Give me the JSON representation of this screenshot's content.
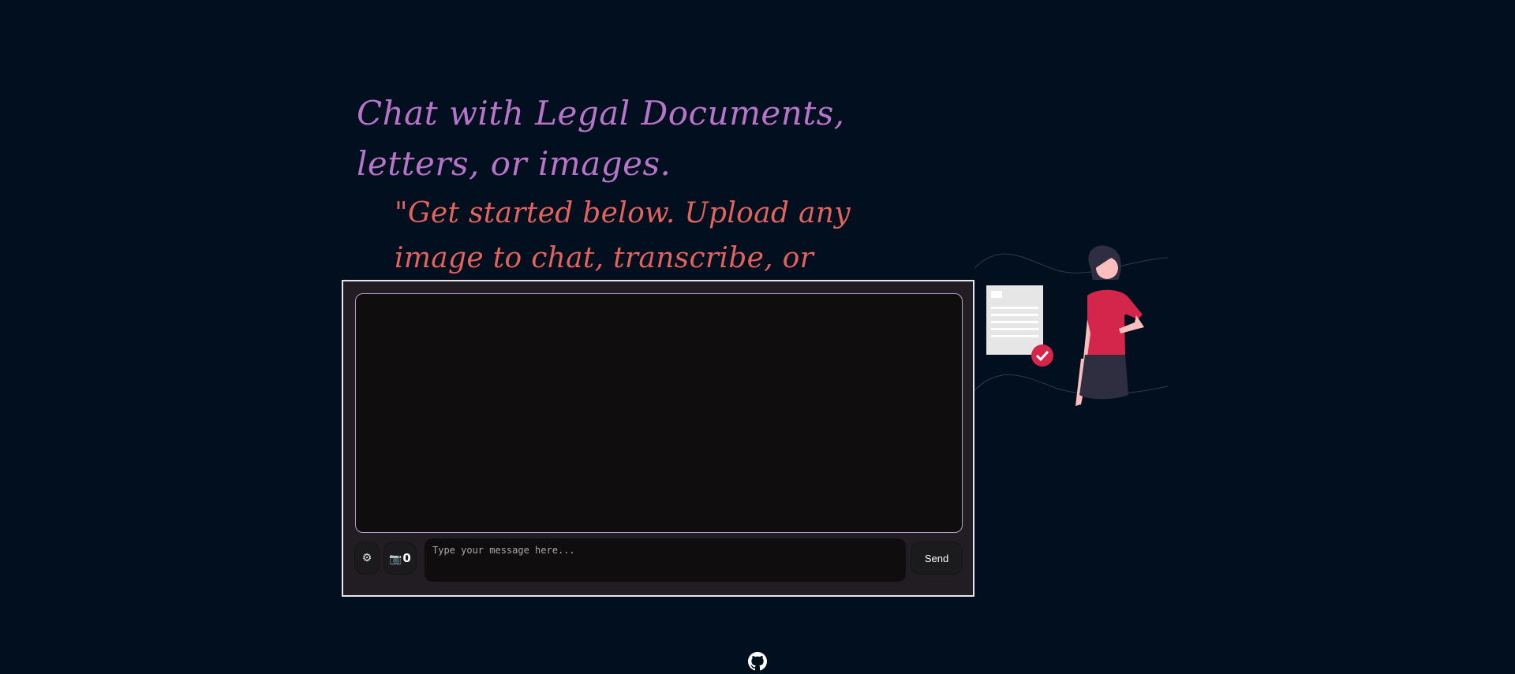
{
  "hero": {
    "title": "Chat with Legal Documents, letters, or images.",
    "subtitle": "\"Get started below. Upload any image to chat, transcribe, or translate.\""
  },
  "chat": {
    "settings_icon": "⚙",
    "upload_icon": "📷",
    "upload_count": "0",
    "input_placeholder": "Type your message here...",
    "send_label": "Send"
  },
  "footer": {
    "github_icon": "github-icon"
  },
  "colors": {
    "background": "#010f1f",
    "title": "#b774c8",
    "subtitle": "#e2635d",
    "card": "#221d22",
    "accent": "#d4264a"
  }
}
